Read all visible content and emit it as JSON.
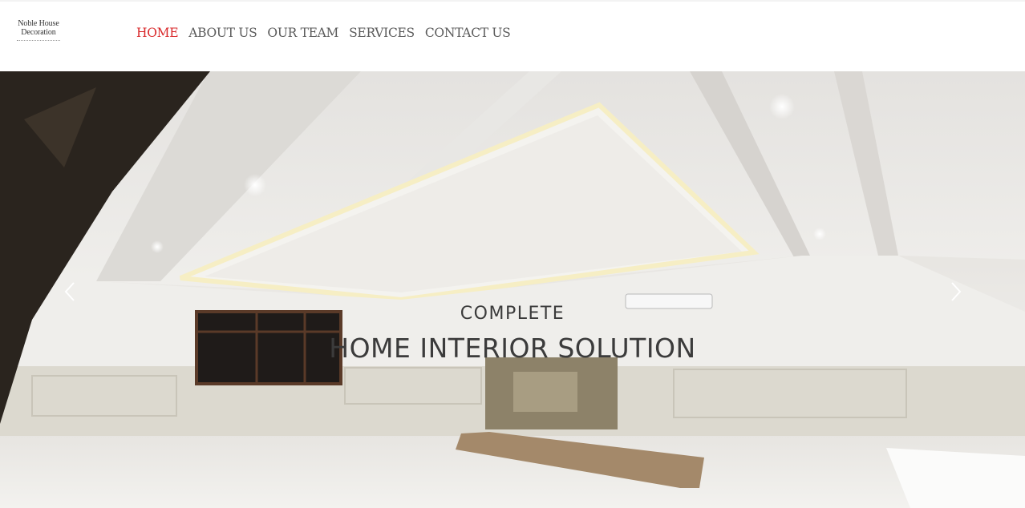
{
  "logo": {
    "line1": "Noble House",
    "line2": "Decoration",
    "tagline": ""
  },
  "nav": {
    "items": [
      {
        "label": "HOME",
        "active": true
      },
      {
        "label": "ABOUT US",
        "active": false
      },
      {
        "label": "OUR TEAM",
        "active": false
      },
      {
        "label": "SERVICES",
        "active": false
      },
      {
        "label": "CONTACT US",
        "active": false
      }
    ]
  },
  "hero": {
    "subtitle": "COMPLETE",
    "title": "HOME INTERIOR SOLUTION",
    "prev_icon": "chevron-left-icon",
    "next_icon": "chevron-right-icon"
  },
  "colors": {
    "accent": "#d9292b",
    "nav_text": "#5a5a5a",
    "caption_text": "#3b3b3b"
  }
}
